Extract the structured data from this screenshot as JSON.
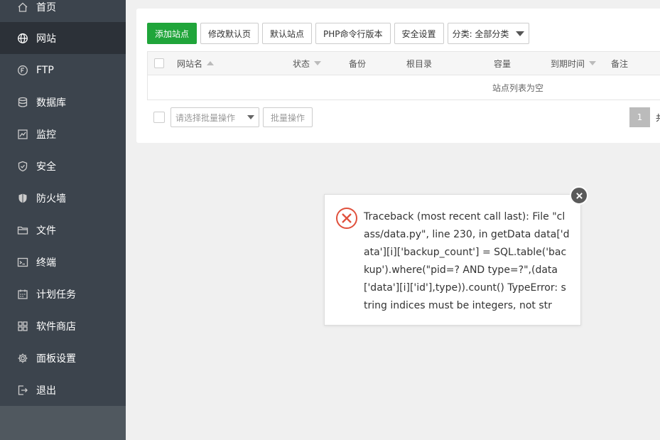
{
  "sidebar": {
    "items": [
      {
        "label": "首页",
        "icon": "home-icon"
      },
      {
        "label": "网站",
        "icon": "globe-icon"
      },
      {
        "label": "FTP",
        "icon": "ftp-icon"
      },
      {
        "label": "数据库",
        "icon": "database-icon"
      },
      {
        "label": "监控",
        "icon": "monitor-icon"
      },
      {
        "label": "安全",
        "icon": "shield-icon"
      },
      {
        "label": "防火墙",
        "icon": "firewall-icon"
      },
      {
        "label": "文件",
        "icon": "folder-icon"
      },
      {
        "label": "终端",
        "icon": "terminal-icon"
      },
      {
        "label": "计划任务",
        "icon": "calendar-icon"
      },
      {
        "label": "软件商店",
        "icon": "apps-icon"
      },
      {
        "label": "面板设置",
        "icon": "gear-icon"
      },
      {
        "label": "退出",
        "icon": "logout-icon"
      }
    ],
    "active": "网站"
  },
  "toolbar": {
    "add_site": "添加站点",
    "edit_default_page": "修改默认页",
    "default_site": "默认站点",
    "php_cli_version": "PHP命令行版本",
    "security_settings": "安全设置",
    "category_select": "分类: 全部分类"
  },
  "table": {
    "columns": [
      "网站名",
      "状态",
      "备份",
      "根目录",
      "容量",
      "到期时间",
      "备注"
    ],
    "empty_text": "站点列表为空"
  },
  "batch": {
    "select_placeholder": "请选择批量操作",
    "button": "批量操作"
  },
  "pagination": {
    "current_page": "1",
    "trailing_text": "共"
  },
  "error_dialog": {
    "message": "Traceback (most recent call last): File \"class/data.py\", line 230, in getData data['data'][i]['backup_count'] = SQL.table('backup').where(\"pid=? AND type=?\",(data['data'][i]['id'],type)).count() TypeError: string indices must be integers, not str"
  },
  "colors": {
    "sidebar_bg": "#3c444d",
    "sidebar_active_bg": "#2c3138",
    "accent_green": "#20a53a",
    "error_red": "#e0503c"
  }
}
